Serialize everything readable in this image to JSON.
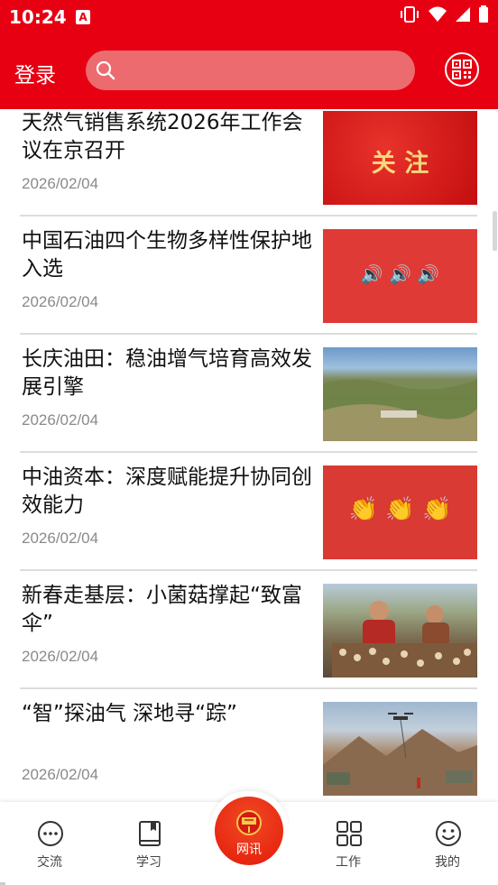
{
  "status_bar": {
    "time": "10:24"
  },
  "header": {
    "login_label": "登录",
    "search_placeholder": ""
  },
  "articles": [
    {
      "title": "天然气销售系统2026年工作会议在京召开",
      "date": "2026/02/04",
      "thumb_text": "关 注"
    },
    {
      "title": "中国石油四个生物多样性保护地入选",
      "date": "2026/02/04",
      "thumb_text": "🔊 🔊 🔊"
    },
    {
      "title": "长庆油田：稳油增气培育高效发展引擎",
      "date": "2026/02/04"
    },
    {
      "title": "中油资本：深度赋能提升协同创效能力",
      "date": "2026/02/04",
      "thumb_text": "👏 👏 👏"
    },
    {
      "title": "新春走基层：小菌菇撑起“致富伞”",
      "date": "2026/02/04"
    },
    {
      "title": "“智”探油气 深地寻“踪”",
      "date": "2026/02/04"
    }
  ],
  "tabbar": {
    "tabs": [
      {
        "label": "交流",
        "icon": "chat-icon"
      },
      {
        "label": "学习",
        "icon": "book-icon"
      },
      {
        "label": "网讯",
        "icon": "league-emblem-icon"
      },
      {
        "label": "工作",
        "icon": "grid-icon"
      },
      {
        "label": "我的",
        "icon": "smiley-icon"
      }
    ]
  },
  "colors": {
    "brand_red": "#e60012",
    "search_bg": "#ec6b6f",
    "date_gray": "#8a8a8a"
  }
}
